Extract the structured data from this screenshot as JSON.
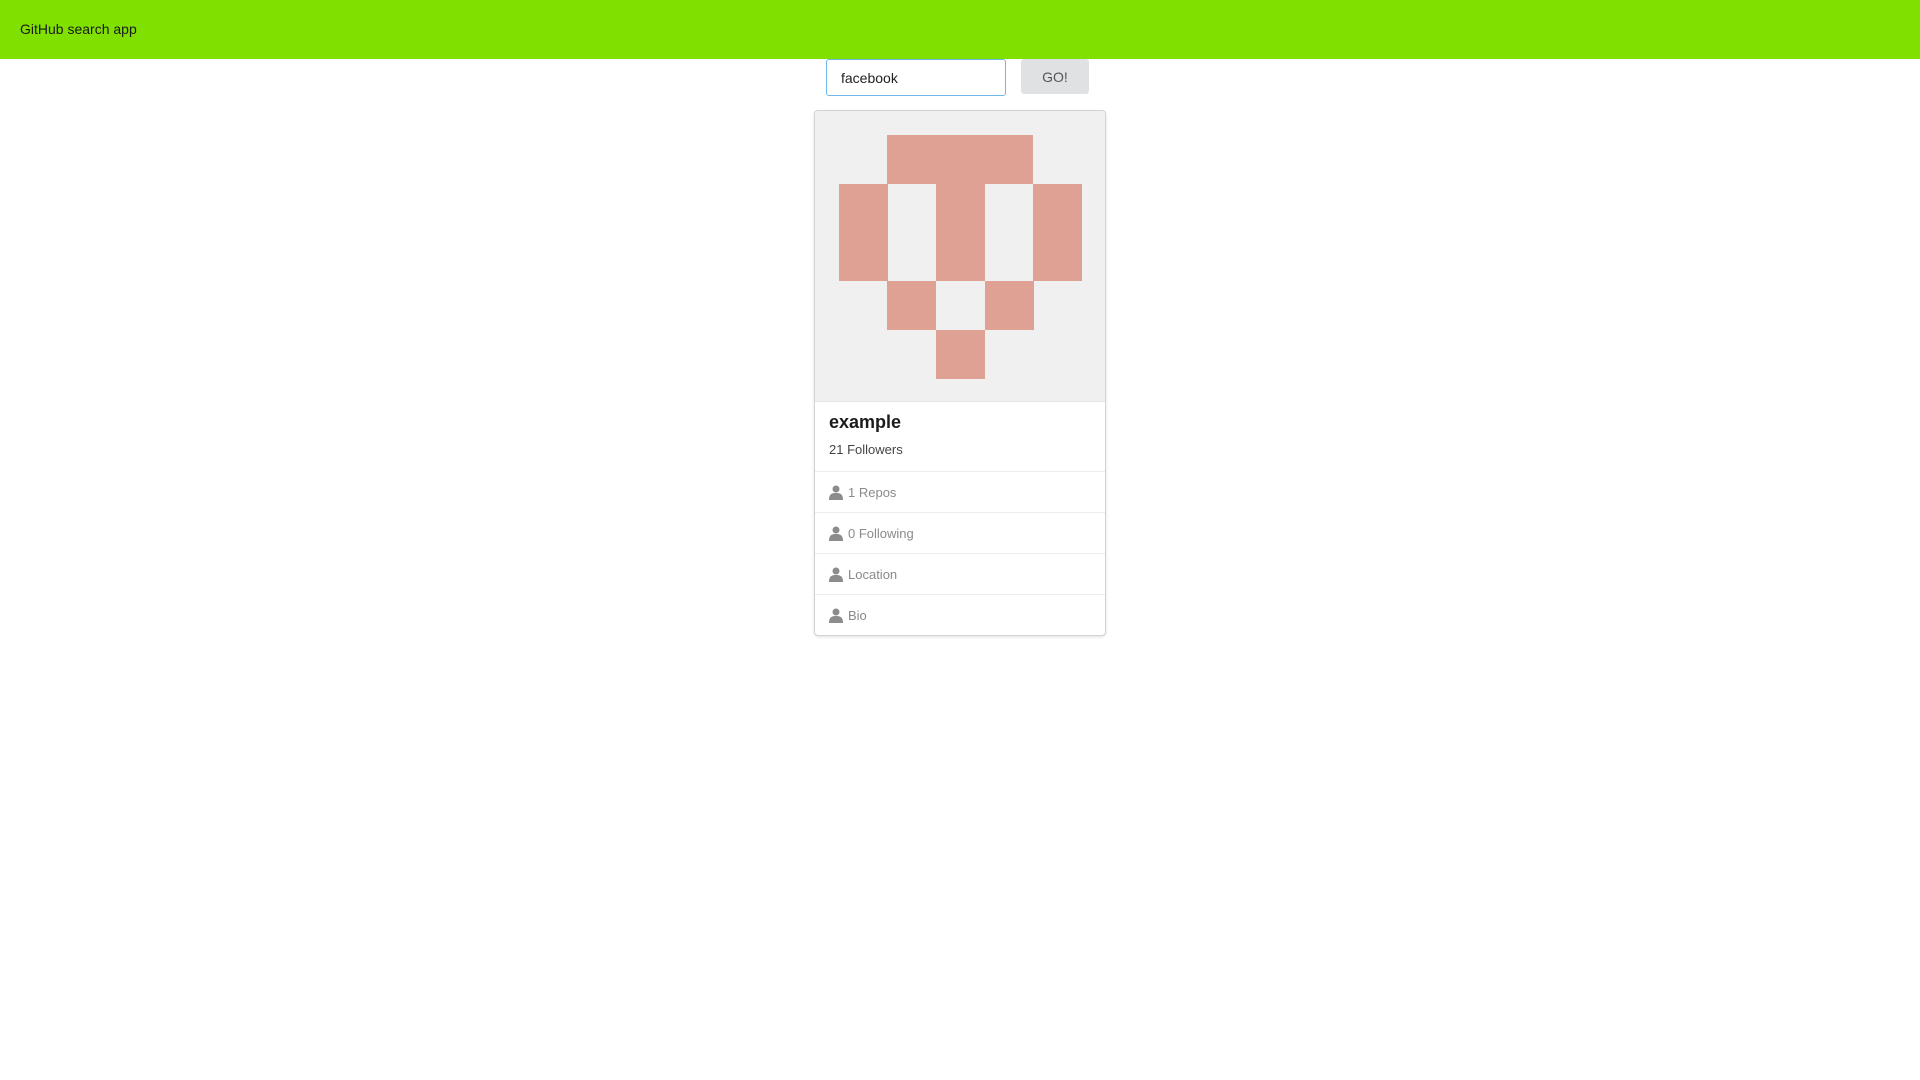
{
  "header": {
    "app_title": "GitHub search app",
    "background_color": "#80e000"
  },
  "search": {
    "value": "facebook",
    "button_label": "GO!"
  },
  "profile_card": {
    "avatar_icon": "identicon-avatar",
    "avatar_color": "#e0a195",
    "name": "example",
    "followers": "21 Followers",
    "details": [
      {
        "icon": "user-icon",
        "label": "1 Repos"
      },
      {
        "icon": "user-icon",
        "label": "0 Following"
      },
      {
        "icon": "user-icon",
        "label": "Location"
      },
      {
        "icon": "user-icon",
        "label": "Bio"
      }
    ]
  }
}
